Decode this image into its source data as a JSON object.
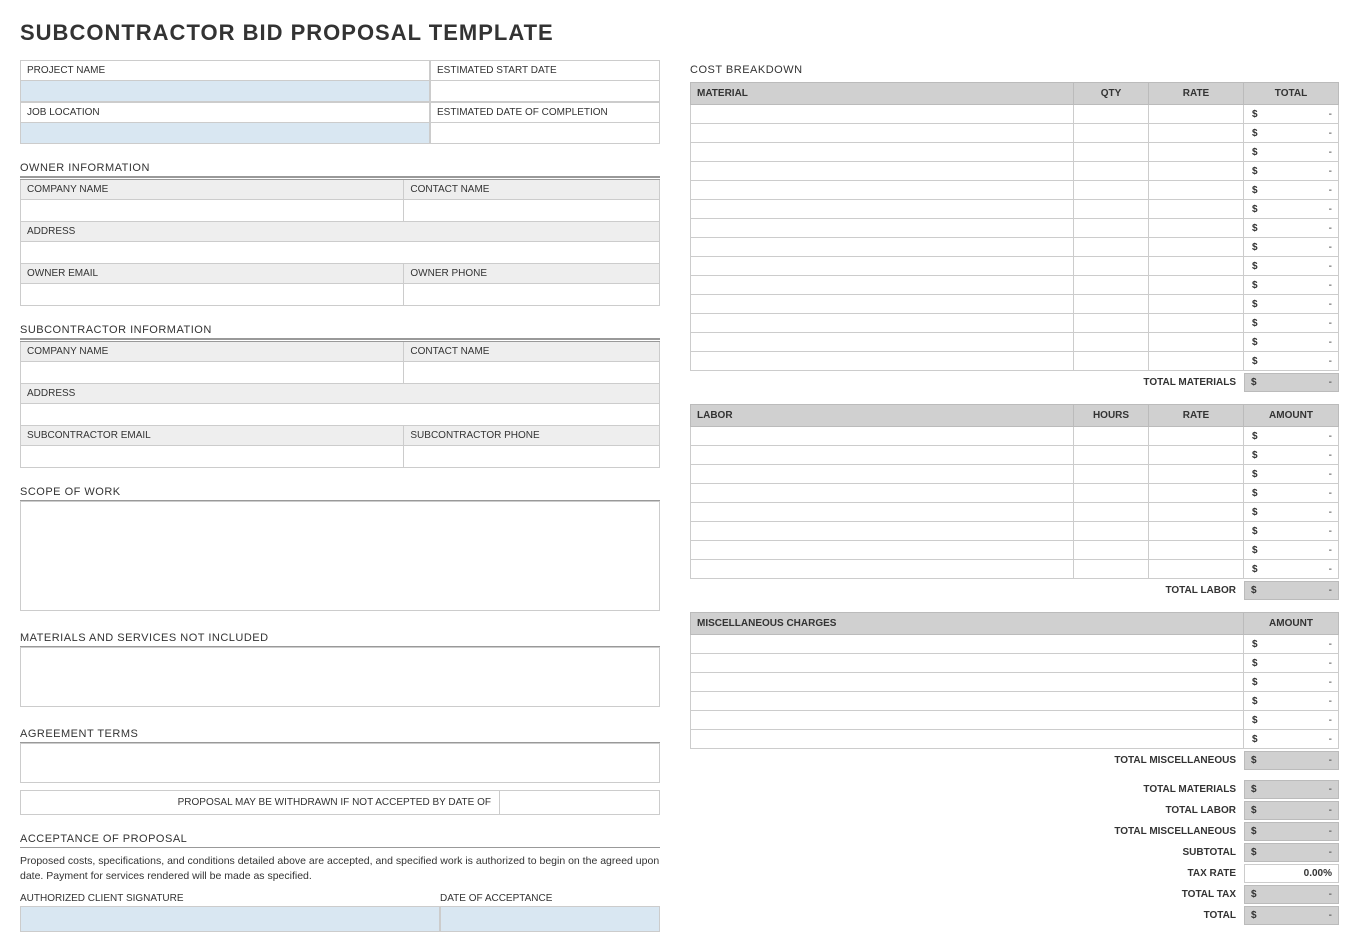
{
  "title": "SUBCONTRACTOR BID PROPOSAL TEMPLATE",
  "left": {
    "project_name_label": "PROJECT NAME",
    "estimated_start_label": "ESTIMATED START DATE",
    "job_location_label": "JOB LOCATION",
    "estimated_completion_label": "ESTIMATED DATE OF COMPLETION",
    "owner_info_heading": "OWNER INFORMATION",
    "company_name_label": "COMPANY NAME",
    "contact_name_label": "CONTACT NAME",
    "address_label": "ADDRESS",
    "owner_email_label": "OWNER EMAIL",
    "owner_phone_label": "OWNER PHONE",
    "sub_info_heading": "SUBCONTRACTOR INFORMATION",
    "sub_email_label": "SUBCONTRACTOR EMAIL",
    "sub_phone_label": "SUBCONTRACTOR PHONE",
    "scope_heading": "SCOPE OF WORK",
    "not_included_heading": "MATERIALS AND SERVICES NOT INCLUDED",
    "agreement_heading": "AGREEMENT TERMS",
    "withdraw_text": "PROPOSAL MAY BE WITHDRAWN IF NOT ACCEPTED BY DATE OF",
    "acceptance_heading": "ACCEPTANCE OF PROPOSAL",
    "acceptance_text": "Proposed costs, specifications, and conditions detailed above are accepted, and specified work is authorized to begin on the agreed upon date.  Payment for services rendered will be made as specified.",
    "signature_label": "AUTHORIZED CLIENT SIGNATURE",
    "date_acceptance_label": "DATE OF ACCEPTANCE"
  },
  "right": {
    "cost_breakdown_heading": "COST BREAKDOWN",
    "material_header": "MATERIAL",
    "qty_header": "QTY",
    "rate_header": "RATE",
    "total_header": "TOTAL",
    "material_rows": 14,
    "total_materials_label": "TOTAL MATERIALS",
    "labor_header": "LABOR",
    "hours_header": "HOURS",
    "amount_header": "AMOUNT",
    "labor_rows": 8,
    "total_labor_label": "TOTAL LABOR",
    "misc_header": "MISCELLANEOUS CHARGES",
    "misc_rows": 6,
    "total_misc_label": "TOTAL MISCELLANEOUS",
    "summary": {
      "total_materials": "TOTAL MATERIALS",
      "total_labor": "TOTAL LABOR",
      "total_misc": "TOTAL MISCELLANEOUS",
      "subtotal": "SUBTOTAL",
      "tax_rate": "TAX RATE",
      "tax_rate_value": "0.00%",
      "total_tax": "TOTAL TAX",
      "total": "TOTAL"
    },
    "currency": "$",
    "dash": "-"
  }
}
